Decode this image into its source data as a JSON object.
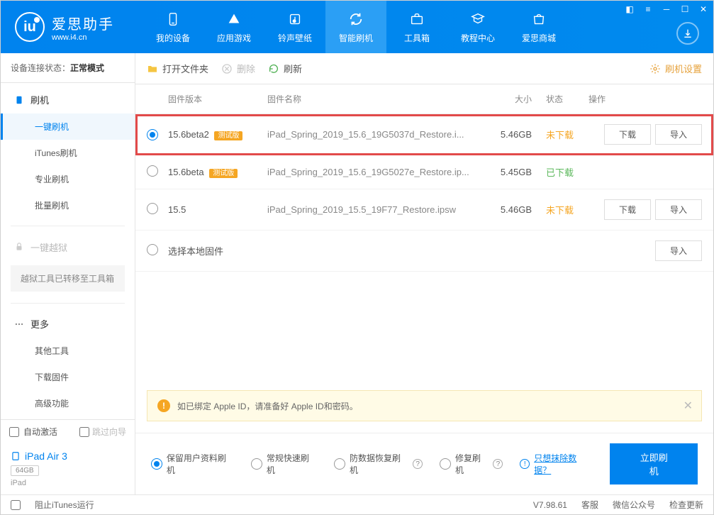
{
  "app": {
    "name": "爱思助手",
    "url": "www.i4.cn"
  },
  "nav": {
    "items": [
      {
        "label": "我的设备",
        "icon": "device"
      },
      {
        "label": "应用游戏",
        "icon": "apps"
      },
      {
        "label": "铃声壁纸",
        "icon": "ringtone"
      },
      {
        "label": "智能刷机",
        "icon": "flash",
        "active": true
      },
      {
        "label": "工具箱",
        "icon": "toolbox"
      },
      {
        "label": "教程中心",
        "icon": "tutorial"
      },
      {
        "label": "爱思商城",
        "icon": "store"
      }
    ]
  },
  "status": {
    "label": "设备连接状态：",
    "value": "正常模式"
  },
  "sidebar": {
    "flash_head": "刷机",
    "flash_items": [
      "一键刷机",
      "iTunes刷机",
      "专业刷机",
      "批量刷机"
    ],
    "jb_head": "一键越狱",
    "jb_note": "越狱工具已转移至工具箱",
    "more_head": "更多",
    "more_items": [
      "其他工具",
      "下载固件",
      "高级功能"
    ]
  },
  "sidefoot": {
    "auto_activate": "自动激活",
    "skip_guide": "跳过向导",
    "device_name": "iPad Air 3",
    "storage": "64GB",
    "device_type": "iPad"
  },
  "toolbar": {
    "open": "打开文件夹",
    "delete": "删除",
    "refresh": "刷新",
    "settings": "刷机设置"
  },
  "table": {
    "headers": {
      "ver": "固件版本",
      "name": "固件名称",
      "size": "大小",
      "status": "状态",
      "ops": "操作"
    },
    "rows": [
      {
        "selected": true,
        "highlighted": true,
        "version": "15.6beta2",
        "beta": "测试版",
        "name": "iPad_Spring_2019_15.6_19G5037d_Restore.i...",
        "size": "5.46GB",
        "status": "未下载",
        "status_kind": "notdl",
        "ops": [
          "下载",
          "导入"
        ]
      },
      {
        "selected": false,
        "version": "15.6beta",
        "beta": "测试版",
        "name": "iPad_Spring_2019_15.6_19G5027e_Restore.ip...",
        "size": "5.45GB",
        "status": "已下载",
        "status_kind": "dl",
        "ops": []
      },
      {
        "selected": false,
        "version": "15.5",
        "beta": "",
        "name": "iPad_Spring_2019_15.5_19F77_Restore.ipsw",
        "size": "5.46GB",
        "status": "未下载",
        "status_kind": "notdl",
        "ops": [
          "下载",
          "导入"
        ]
      },
      {
        "selected": false,
        "version": "选择本地固件",
        "beta": "",
        "name": "",
        "size": "",
        "status": "",
        "status_kind": "",
        "ops": [
          "导入"
        ]
      }
    ]
  },
  "notice": "如已绑定 Apple ID，请准备好 Apple ID和密码。",
  "options": {
    "items": [
      "保留用户资料刷机",
      "常规快速刷机",
      "防数据恢复刷机",
      "修复刷机"
    ],
    "selected": 0,
    "link": "只想抹除数据？",
    "button": "立即刷机"
  },
  "footer": {
    "block_itunes": "阻止iTunes运行",
    "version": "V7.98.61",
    "items": [
      "客服",
      "微信公众号",
      "检查更新"
    ]
  }
}
